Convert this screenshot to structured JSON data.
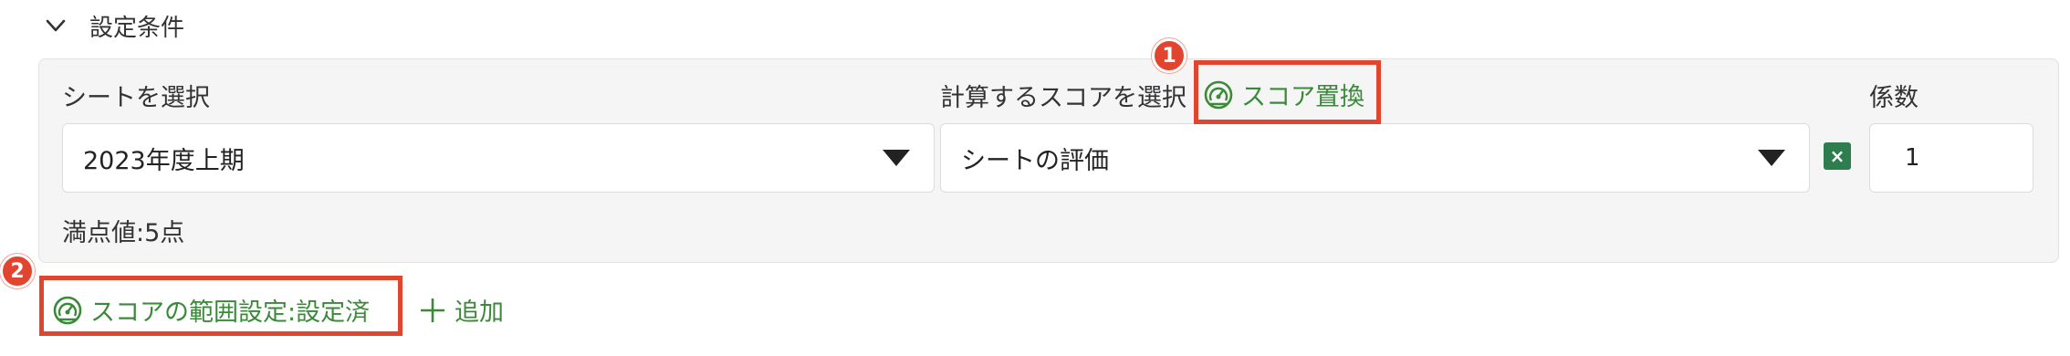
{
  "section": {
    "title": "設定条件"
  },
  "sheet": {
    "label": "シートを選択",
    "value": "2023年度上期"
  },
  "score": {
    "label": "計算するスコアを選択",
    "value": "シートの評価",
    "replace_link": "スコア置換"
  },
  "coefficient": {
    "label": "係数",
    "value": "1",
    "remove_icon": "×"
  },
  "max_score": "満点値:5点",
  "range_setting_link": "スコアの範囲設定:設定済",
  "add_link": "追加",
  "markers": {
    "one": "1",
    "two": "2"
  },
  "colors": {
    "accent_green": "#3a8a3a",
    "highlight_red": "#e2452f",
    "remove_green": "#2e7d4f"
  },
  "icons": [
    "chevron-down-icon",
    "gauge-icon",
    "dropdown-caret-icon",
    "close-icon",
    "plus-icon"
  ]
}
